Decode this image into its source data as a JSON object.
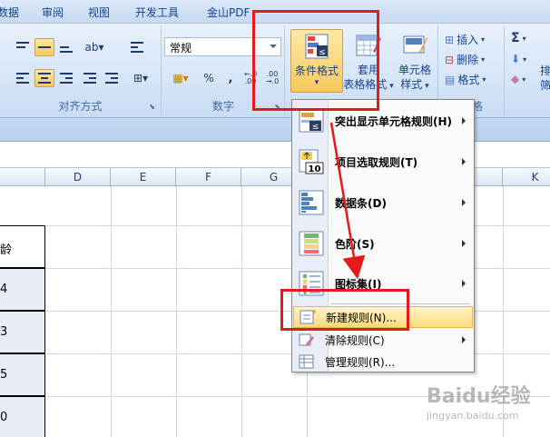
{
  "menu": {
    "items": [
      "数据",
      "审阅",
      "视图",
      "开发工具",
      "金山PDF"
    ]
  },
  "ribbon": {
    "number_format": "常规",
    "alignment_label": "对齐方式",
    "number_label": "数字",
    "percent": "%",
    "comma": ",",
    "inc_decimal": ".0\n.00",
    "conditional_format": {
      "line1": "条件格式",
      "arrow": "▾"
    },
    "table_format": {
      "line1": "套用",
      "line2": "表格格式"
    },
    "cell_style": {
      "line1": "单元格",
      "line2": "样式"
    },
    "insert": "插入",
    "delete": "删除",
    "format": "格式",
    "cells_label": "格",
    "sigma": "Σ",
    "partial_right": "排",
    "partial_right2": "筛"
  },
  "sheet": {
    "columns": [
      "D",
      "E",
      "F",
      "G",
      "K"
    ],
    "cells": [
      "龄",
      "4",
      "3",
      "5",
      "0"
    ]
  },
  "cf_menu": {
    "items": [
      {
        "label": "突出显示单元格规则(H)",
        "icon": "highlight-rules-icon",
        "submenu": true
      },
      {
        "label": "项目选取规则(T)",
        "icon": "top-bottom-rules-icon",
        "submenu": true
      },
      {
        "label": "数据条(D)",
        "icon": "data-bars-icon",
        "submenu": true
      },
      {
        "label": "色阶(S)",
        "icon": "color-scales-icon",
        "submenu": true
      },
      {
        "label": "图标集(I)",
        "icon": "icon-sets-icon",
        "submenu": true
      }
    ],
    "small_items": [
      {
        "label": "新建规则(N)...",
        "icon": "new-rule-icon",
        "highlighted": true
      },
      {
        "label": "清除规则(C)",
        "icon": "clear-rules-icon",
        "submenu": true
      },
      {
        "label": "管理规则(R)...",
        "icon": "manage-rules-icon"
      }
    ]
  },
  "watermark": {
    "brand": "Baidu经验",
    "url": "jingyan.baidu.com"
  },
  "colors": {
    "annotation_red": "#e41a1c",
    "highlight": "#fddb7c"
  }
}
